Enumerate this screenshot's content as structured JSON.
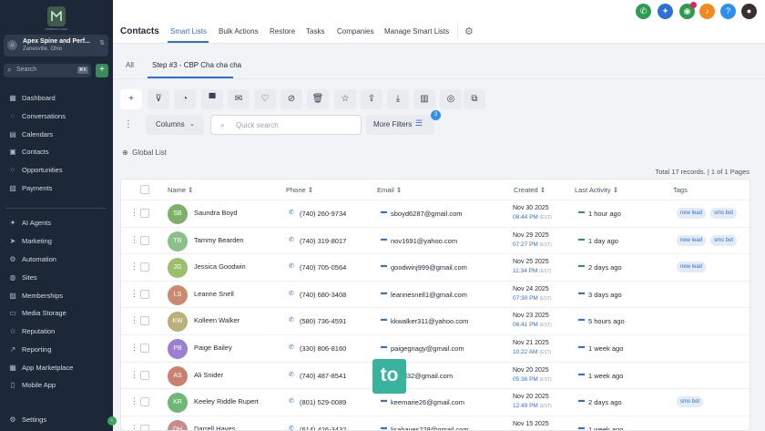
{
  "brand": {
    "logo_text": "COMPANY LOGO",
    "color": "#3a8b59"
  },
  "account": {
    "name": "Apex Spine and Perf...",
    "location": "Zanesville, Ohio"
  },
  "search": {
    "placeholder": "Search",
    "shortcut": "⌘K"
  },
  "nav": [
    {
      "label": "Dashboard",
      "icon": "grid-icon"
    },
    {
      "label": "Conversations",
      "icon": "chat-icon"
    },
    {
      "label": "Calendars",
      "icon": "calendar-icon"
    },
    {
      "label": "Contacts",
      "icon": "contacts-icon"
    },
    {
      "label": "Opportunities",
      "icon": "opportunities-icon"
    },
    {
      "label": "Payments",
      "icon": "payments-icon"
    },
    {
      "label": "AI Agents",
      "icon": "sparkle-icon"
    },
    {
      "label": "Marketing",
      "icon": "send-icon"
    },
    {
      "label": "Automation",
      "icon": "automation-icon"
    },
    {
      "label": "Sites",
      "icon": "globe-icon"
    },
    {
      "label": "Memberships",
      "icon": "membership-icon"
    },
    {
      "label": "Media Storage",
      "icon": "folder-icon"
    },
    {
      "label": "Reputation",
      "icon": "star-icon"
    },
    {
      "label": "Reporting",
      "icon": "chart-icon"
    },
    {
      "label": "App Marketplace",
      "icon": "apps-icon"
    },
    {
      "label": "Mobile App",
      "icon": "phone-icon"
    },
    {
      "label": "Settings",
      "icon": "gear-icon"
    }
  ],
  "header": {
    "title": "Contacts",
    "tabs": [
      "Smart Lists",
      "Bulk Actions",
      "Restore",
      "Tasks",
      "Companies",
      "Manage Smart Lists"
    ]
  },
  "subtabs": [
    "All",
    "Step #3 - CBP Cha cha cha"
  ],
  "toolbar": {
    "columns_label": "Columns",
    "search_placeholder": "Quick search",
    "more_filters": "More Filters",
    "filter_count": "3"
  },
  "global_list": "Global List",
  "totals": "Total 17 records. | 1 of 1 Pages",
  "columns": [
    "Name",
    "Phone",
    "Email",
    "Created",
    "Last Activity",
    "Tags"
  ],
  "rows": [
    {
      "initials": "SB",
      "name": "Saundra Boyd",
      "phone": "(740) 260-9734",
      "email": "sboyd6287@gmail.com",
      "date": "Nov 30 2025",
      "time": "08:44 PM",
      "tz": "(EST)",
      "activity": "1 hour ago",
      "tags": [
        "new lead",
        "sms bot"
      ],
      "color": "#7fb069"
    },
    {
      "initials": "TB",
      "name": "Tammy Bearden",
      "phone": "(740) 319-8017",
      "email": "nov1691@yahoo.com",
      "date": "Nov 29 2025",
      "time": "07:27 PM",
      "tz": "(EST)",
      "activity": "1 day ago",
      "tags": [
        "new lead",
        "sms bot"
      ],
      "color": "#8bc089"
    },
    {
      "initials": "JG",
      "name": "Jessica Goodwin",
      "phone": "(740) 705-0564",
      "email": "goodwinj999@gmail.com",
      "date": "Nov 25 2025",
      "time": "11:34 PM",
      "tz": "(EST)",
      "activity": "2 days ago",
      "tags": [
        "new lead"
      ],
      "color": "#9cbf6b"
    },
    {
      "initials": "LS",
      "name": "Leanne Snell",
      "phone": "(740) 680-3408",
      "email": "leannesnell1@gmail.com",
      "date": "Nov 24 2025",
      "time": "07:30 PM",
      "tz": "(EST)",
      "activity": "3 days ago",
      "tags": [],
      "color": "#c98a6f"
    },
    {
      "initials": "KW",
      "name": "Kolleen Walker",
      "phone": "(580) 736-4591",
      "email": "kkwalker311@yahoo.com",
      "date": "Nov 23 2025",
      "time": "06:41 PM",
      "tz": "(EST)",
      "activity": "5 hours ago",
      "tags": [],
      "color": "#b9b07a"
    },
    {
      "initials": "PB",
      "name": "Paige Bailey",
      "phone": "(330) 806-8160",
      "email": "paigegnagy@gmail.com",
      "date": "Nov 21 2025",
      "time": "10:22 AM",
      "tz": "(EST)",
      "activity": "1 week ago",
      "tags": [],
      "color": "#9b7fd0"
    },
    {
      "initials": "AS",
      "name": "Ali Snider",
      "phone": "(740) 487-8541",
      "email": "asnid32@gmail.com",
      "date": "Nov 20 2025",
      "time": "05:36 PM",
      "tz": "(EST)",
      "activity": "1 week ago",
      "tags": [],
      "color": "#c9826f"
    },
    {
      "initials": "KR",
      "name": "Keeley Riddle Rupert",
      "phone": "(801) 529-0089",
      "email": "keemarie26@gmail.com",
      "date": "Nov 20 2025",
      "time": "12:49 PM",
      "tz": "(EST)",
      "activity": "2 days ago",
      "tags": [
        "sms bot"
      ],
      "color": "#6fb777"
    },
    {
      "initials": "DH",
      "name": "Darrell Hayes",
      "phone": "(614) 426-3432",
      "email": "lisahayes728@gmail.com",
      "date": "Nov 15 2025",
      "time": "",
      "tz": "",
      "activity": "1 week ago",
      "tags": [],
      "color": "#c98a8a"
    }
  ],
  "overlay_text": "to"
}
